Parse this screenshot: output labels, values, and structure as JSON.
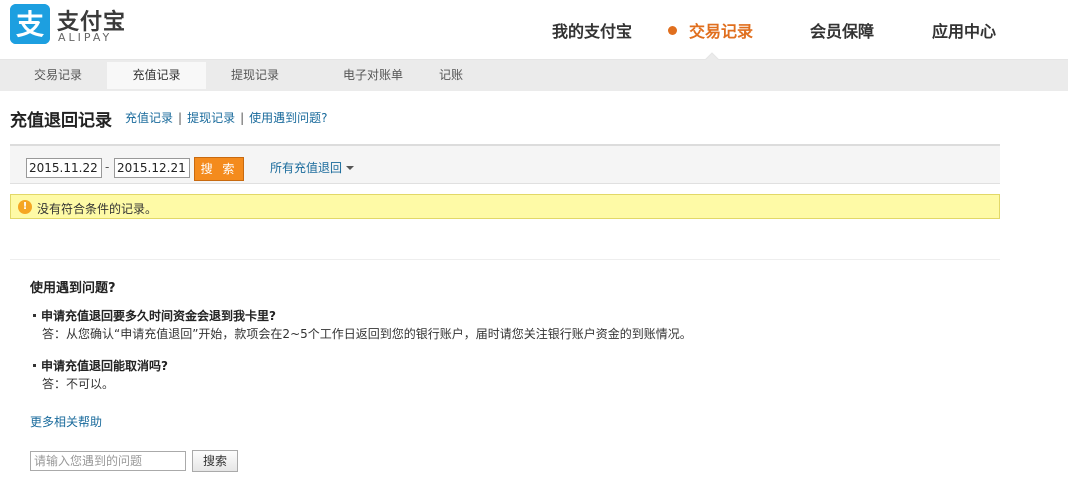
{
  "header": {
    "logo_cn": "支付宝",
    "logo_en": "ALIPAY",
    "nav": [
      {
        "label": "我的支付宝"
      },
      {
        "label": "交易记录"
      },
      {
        "label": "会员保障"
      },
      {
        "label": "应用中心"
      }
    ]
  },
  "sub_nav": [
    {
      "label": "交易记录"
    },
    {
      "label": "充值记录"
    },
    {
      "label": "提现记录"
    },
    {
      "label": "电子对账单"
    },
    {
      "label": "记账"
    }
  ],
  "page": {
    "title": "充值退回记录",
    "links": [
      "充值记录",
      "提现记录",
      "使用遇到问题?"
    ],
    "separator": "|"
  },
  "search": {
    "start_date": "2015.11.22",
    "end_date": "2015.12.21",
    "dash": "-",
    "button": "搜 索",
    "filter": "所有充值退回"
  },
  "notice": {
    "icon": "!",
    "text": "没有符合条件的记录。"
  },
  "help": {
    "title": "使用遇到问题?",
    "faqs": [
      {
        "q": "申请充值退回要多久时间资金会退到我卡里?",
        "a": "答：从您确认“申请充值退回”开始，款项会在2~5个工作日返回到您的银行账户，届时请您关注银行账户资金的到账情况。"
      },
      {
        "q": "申请充值退回能取消吗?",
        "a": "答：不可以。"
      }
    ],
    "more": "更多相关帮助",
    "search_placeholder": "请输入您遇到的问题",
    "search_button": "搜索"
  },
  "colors": {
    "accent": "#e06f1e",
    "link": "#1a6b9c",
    "logo_blue": "#1d9fe0",
    "notice_bg": "#fefaa6"
  }
}
